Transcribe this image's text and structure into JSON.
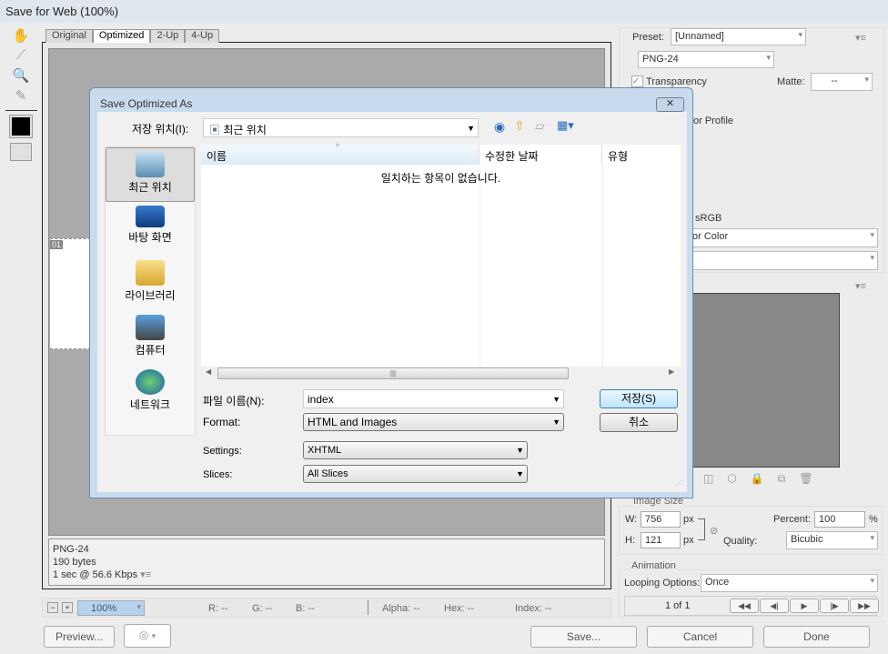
{
  "window": {
    "title": "Save for Web (100%)"
  },
  "tools": [
    {
      "icon": "hand-icon",
      "glyph": "✋"
    },
    {
      "icon": "slice-select-icon",
      "glyph": "⟋"
    },
    {
      "icon": "zoom-icon",
      "glyph": "🔍"
    },
    {
      "icon": "eyedropper-icon",
      "glyph": "✎"
    }
  ],
  "tabs": [
    "Original",
    "Optimized",
    "2-Up",
    "4-Up"
  ],
  "slice_label": "01",
  "info": {
    "format": "PNG-24",
    "size": "190 bytes",
    "time": "1 sec @ 56.6 Kbps"
  },
  "status": {
    "zoom": "100%",
    "r": "R: --",
    "g": "G: --",
    "b": "B: --",
    "alpha": "Alpha: --",
    "hex": "Hex: --",
    "index": "Index: --"
  },
  "bottom": {
    "preview": "Preview...",
    "save": "Save...",
    "cancel": "Cancel",
    "done": "Done"
  },
  "settings": {
    "preset_label": "Preset:",
    "preset": "[Unnamed]",
    "format": "PNG-24",
    "transparency": "Transparency",
    "transparency_checked": true,
    "matte_label": "Matte:",
    "matte": "--",
    "color_profile": "or Profile",
    "srgb": "sRGB",
    "color_mode": "or Color",
    "color_mode2": ""
  },
  "image_size": {
    "title": "Image Size",
    "w_label": "W:",
    "w": "756",
    "h_label": "H:",
    "h": "121",
    "px": "px",
    "percent_label": "Percent:",
    "percent": "100",
    "pct": "%",
    "quality_label": "Quality:",
    "quality": "Bicubic"
  },
  "animation": {
    "title": "Animation",
    "looping_label": "Looping Options:",
    "looping": "Once",
    "frame": "1 of 1"
  },
  "dialog": {
    "title": "Save Optimized As",
    "location_label": "저장 위치(I):",
    "location": "최근 위치",
    "places": [
      "최근 위치",
      "바탕 화면",
      "라이브러리",
      "컴퓨터",
      "네트워크"
    ],
    "columns": [
      "이름",
      "수정한 날짜",
      "유형"
    ],
    "empty": "일치하는 항목이 없습니다.",
    "filename_label": "파일 이름(N):",
    "filename": "index",
    "format_label": "Format:",
    "format": "HTML and Images",
    "settings_label": "Settings:",
    "settings": "XHTML",
    "slices_label": "Slices:",
    "slices": "All Slices",
    "save": "저장(S)",
    "cancel": "취소"
  }
}
